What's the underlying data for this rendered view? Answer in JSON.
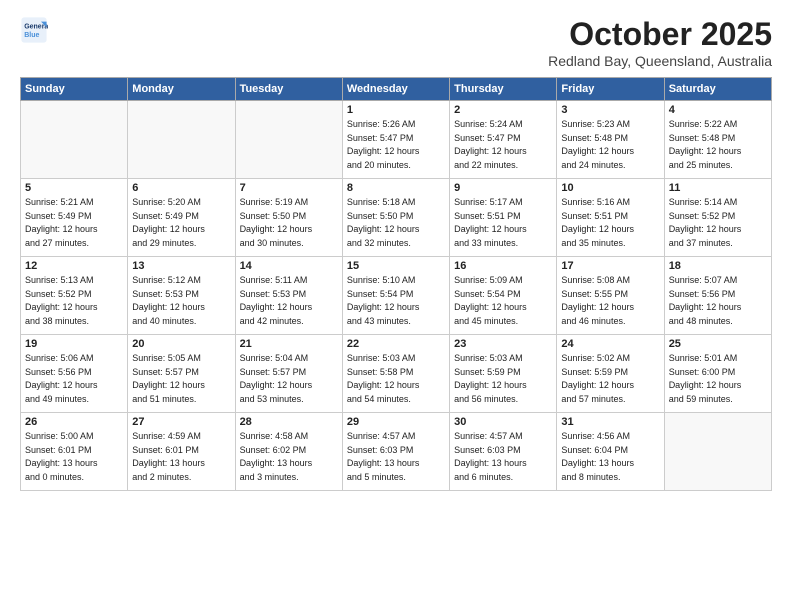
{
  "header": {
    "logo_line1": "General",
    "logo_line2": "Blue",
    "month_title": "October 2025",
    "location": "Redland Bay, Queensland, Australia"
  },
  "weekdays": [
    "Sunday",
    "Monday",
    "Tuesday",
    "Wednesday",
    "Thursday",
    "Friday",
    "Saturday"
  ],
  "weeks": [
    [
      {
        "day": "",
        "info": "",
        "empty": true
      },
      {
        "day": "",
        "info": "",
        "empty": true
      },
      {
        "day": "",
        "info": "",
        "empty": true
      },
      {
        "day": "1",
        "info": "Sunrise: 5:26 AM\nSunset: 5:47 PM\nDaylight: 12 hours\nand 20 minutes."
      },
      {
        "day": "2",
        "info": "Sunrise: 5:24 AM\nSunset: 5:47 PM\nDaylight: 12 hours\nand 22 minutes."
      },
      {
        "day": "3",
        "info": "Sunrise: 5:23 AM\nSunset: 5:48 PM\nDaylight: 12 hours\nand 24 minutes."
      },
      {
        "day": "4",
        "info": "Sunrise: 5:22 AM\nSunset: 5:48 PM\nDaylight: 12 hours\nand 25 minutes."
      }
    ],
    [
      {
        "day": "5",
        "info": "Sunrise: 5:21 AM\nSunset: 5:49 PM\nDaylight: 12 hours\nand 27 minutes."
      },
      {
        "day": "6",
        "info": "Sunrise: 5:20 AM\nSunset: 5:49 PM\nDaylight: 12 hours\nand 29 minutes."
      },
      {
        "day": "7",
        "info": "Sunrise: 5:19 AM\nSunset: 5:50 PM\nDaylight: 12 hours\nand 30 minutes."
      },
      {
        "day": "8",
        "info": "Sunrise: 5:18 AM\nSunset: 5:50 PM\nDaylight: 12 hours\nand 32 minutes."
      },
      {
        "day": "9",
        "info": "Sunrise: 5:17 AM\nSunset: 5:51 PM\nDaylight: 12 hours\nand 33 minutes."
      },
      {
        "day": "10",
        "info": "Sunrise: 5:16 AM\nSunset: 5:51 PM\nDaylight: 12 hours\nand 35 minutes."
      },
      {
        "day": "11",
        "info": "Sunrise: 5:14 AM\nSunset: 5:52 PM\nDaylight: 12 hours\nand 37 minutes."
      }
    ],
    [
      {
        "day": "12",
        "info": "Sunrise: 5:13 AM\nSunset: 5:52 PM\nDaylight: 12 hours\nand 38 minutes."
      },
      {
        "day": "13",
        "info": "Sunrise: 5:12 AM\nSunset: 5:53 PM\nDaylight: 12 hours\nand 40 minutes."
      },
      {
        "day": "14",
        "info": "Sunrise: 5:11 AM\nSunset: 5:53 PM\nDaylight: 12 hours\nand 42 minutes."
      },
      {
        "day": "15",
        "info": "Sunrise: 5:10 AM\nSunset: 5:54 PM\nDaylight: 12 hours\nand 43 minutes."
      },
      {
        "day": "16",
        "info": "Sunrise: 5:09 AM\nSunset: 5:54 PM\nDaylight: 12 hours\nand 45 minutes."
      },
      {
        "day": "17",
        "info": "Sunrise: 5:08 AM\nSunset: 5:55 PM\nDaylight: 12 hours\nand 46 minutes."
      },
      {
        "day": "18",
        "info": "Sunrise: 5:07 AM\nSunset: 5:56 PM\nDaylight: 12 hours\nand 48 minutes."
      }
    ],
    [
      {
        "day": "19",
        "info": "Sunrise: 5:06 AM\nSunset: 5:56 PM\nDaylight: 12 hours\nand 49 minutes."
      },
      {
        "day": "20",
        "info": "Sunrise: 5:05 AM\nSunset: 5:57 PM\nDaylight: 12 hours\nand 51 minutes."
      },
      {
        "day": "21",
        "info": "Sunrise: 5:04 AM\nSunset: 5:57 PM\nDaylight: 12 hours\nand 53 minutes."
      },
      {
        "day": "22",
        "info": "Sunrise: 5:03 AM\nSunset: 5:58 PM\nDaylight: 12 hours\nand 54 minutes."
      },
      {
        "day": "23",
        "info": "Sunrise: 5:03 AM\nSunset: 5:59 PM\nDaylight: 12 hours\nand 56 minutes."
      },
      {
        "day": "24",
        "info": "Sunrise: 5:02 AM\nSunset: 5:59 PM\nDaylight: 12 hours\nand 57 minutes."
      },
      {
        "day": "25",
        "info": "Sunrise: 5:01 AM\nSunset: 6:00 PM\nDaylight: 12 hours\nand 59 minutes."
      }
    ],
    [
      {
        "day": "26",
        "info": "Sunrise: 5:00 AM\nSunset: 6:01 PM\nDaylight: 13 hours\nand 0 minutes."
      },
      {
        "day": "27",
        "info": "Sunrise: 4:59 AM\nSunset: 6:01 PM\nDaylight: 13 hours\nand 2 minutes."
      },
      {
        "day": "28",
        "info": "Sunrise: 4:58 AM\nSunset: 6:02 PM\nDaylight: 13 hours\nand 3 minutes."
      },
      {
        "day": "29",
        "info": "Sunrise: 4:57 AM\nSunset: 6:03 PM\nDaylight: 13 hours\nand 5 minutes."
      },
      {
        "day": "30",
        "info": "Sunrise: 4:57 AM\nSunset: 6:03 PM\nDaylight: 13 hours\nand 6 minutes."
      },
      {
        "day": "31",
        "info": "Sunrise: 4:56 AM\nSunset: 6:04 PM\nDaylight: 13 hours\nand 8 minutes."
      },
      {
        "day": "",
        "info": "",
        "empty": true
      }
    ]
  ]
}
